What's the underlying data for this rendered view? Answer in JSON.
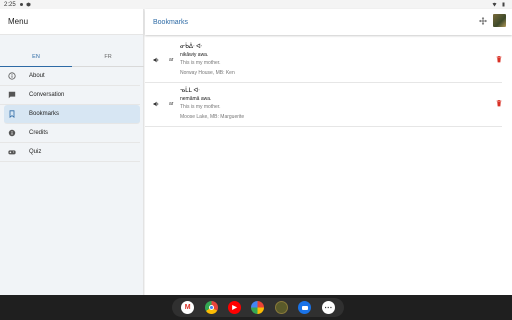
{
  "status": {
    "time": "2:25"
  },
  "sidebar": {
    "title": "Menu",
    "lang_tabs": [
      {
        "label": "EN"
      },
      {
        "label": "FR"
      }
    ],
    "items": [
      {
        "label": "About"
      },
      {
        "label": "Conversation"
      },
      {
        "label": "Bookmarks"
      },
      {
        "label": "Credits"
      },
      {
        "label": "Quiz"
      }
    ]
  },
  "main": {
    "title": "Bookmarks",
    "bookmarks": [
      {
        "syllabics": "ᓂᑳᐄᐧ ᐊᐧ",
        "roman": "nikâwiy awa.",
        "english": "This is my mother.",
        "place": "Norway House, MB: Ken"
      },
      {
        "syllabics": "ᓀᒫᒪ ᐊᐧ",
        "roman": "nemâmâ awa.",
        "english": "This is my mother.",
        "place": "Moose Lake, MB: Marguerite"
      }
    ],
    "ipa_label": "ar"
  },
  "taskbar": {
    "apps": [
      {
        "name": "gmail",
        "glyph": "M",
        "color": "#ffffff"
      },
      {
        "name": "chrome",
        "glyph": "",
        "color": "#e8453c"
      },
      {
        "name": "youtube",
        "glyph": "▶",
        "color": "#ff0000"
      },
      {
        "name": "photos",
        "glyph": "",
        "color": "#fbbc04"
      },
      {
        "name": "custom-app",
        "glyph": "",
        "color": "#5a5a2a"
      },
      {
        "name": "messages",
        "glyph": "",
        "color": "#1a73e8"
      },
      {
        "name": "app-drawer",
        "glyph": "⋯",
        "color": "#ffffff"
      }
    ]
  },
  "colors": {
    "accent": "#2d6aa5",
    "delete": "#d93025",
    "active_bg": "#d7e6f3"
  }
}
